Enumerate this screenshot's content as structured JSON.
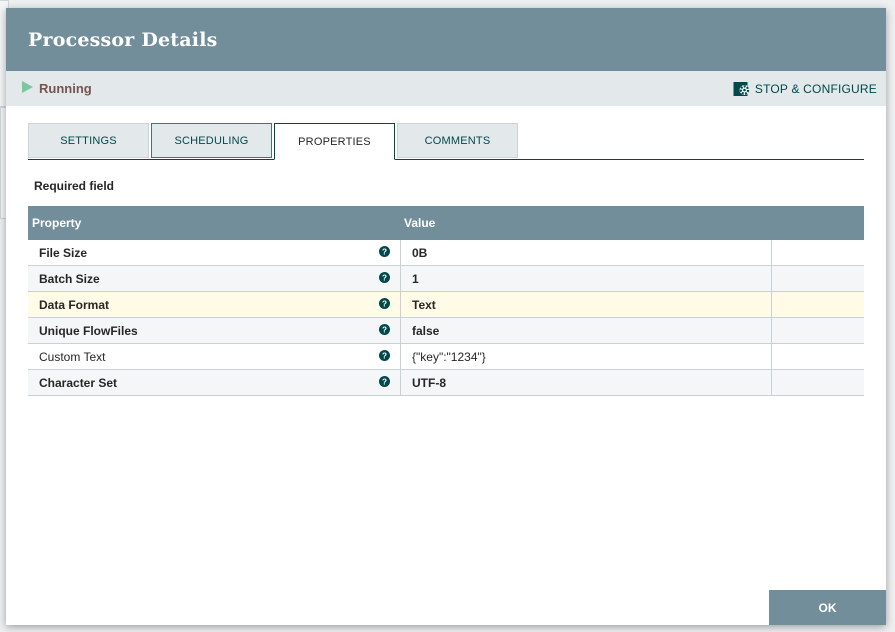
{
  "dialog": {
    "title": "Processor Details",
    "status": "Running",
    "stop_configure_label": "STOP & CONFIGURE",
    "ok_label": "OK"
  },
  "tabs": [
    {
      "label": "SETTINGS"
    },
    {
      "label": "SCHEDULING"
    },
    {
      "label": "PROPERTIES",
      "active": true
    },
    {
      "label": "COMMENTS"
    }
  ],
  "properties": {
    "required_label": "Required field",
    "header": {
      "property": "Property",
      "value": "Value"
    },
    "rows": [
      {
        "name": "File Size",
        "value": "0B",
        "required": true
      },
      {
        "name": "Batch Size",
        "value": "1",
        "required": true
      },
      {
        "name": "Data Format",
        "value": "Text",
        "required": true,
        "selected": true
      },
      {
        "name": "Unique FlowFiles",
        "value": "false",
        "required": true
      },
      {
        "name": "Custom Text",
        "value": "{\"key\":\"1234\"}",
        "required": false
      },
      {
        "name": "Character Set",
        "value": "UTF-8",
        "required": true
      }
    ]
  },
  "icons": {
    "status": "play-icon",
    "stop_configure": "gear-stop-icon",
    "help": "question-circle-icon"
  },
  "colors": {
    "header": "#728e9b",
    "accent": "#004849",
    "running": "#7dc7a0",
    "selected_row": "#fffbe6"
  }
}
